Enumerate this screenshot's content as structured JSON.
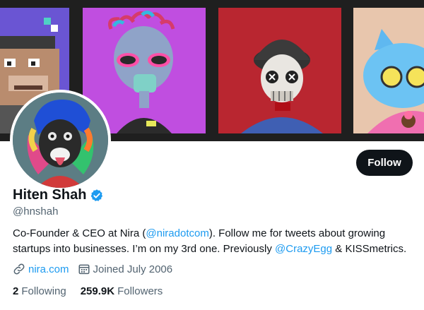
{
  "banner": {
    "nfts": [
      {
        "name": "pixel-ape"
      },
      {
        "name": "masked-alien"
      },
      {
        "name": "skull-soldier"
      },
      {
        "name": "cool-cat"
      }
    ]
  },
  "profile": {
    "display_name": "Hiten Shah",
    "handle": "@hnshah",
    "follow_label": "Follow",
    "bio": {
      "part1": "Co-Founder & CEO at Nira (",
      "mention1": "@niradotcom",
      "part2": "). Follow me for tweets about growing startups into businesses. I’m on my 3rd one. Previously ",
      "mention2": "@CrazyEgg",
      "part3": " & KISSmetrics."
    },
    "website": "nira.com",
    "joined": "Joined July 2006",
    "following_count": "2",
    "following_label": "Following",
    "followers_count": "259.9K",
    "followers_label": "Followers"
  },
  "colors": {
    "accent": "#1d9bf0",
    "text_primary": "#0f1419",
    "text_secondary": "#536471",
    "button_bg": "#0f1419"
  },
  "icons": {
    "verified": "verified-badge-icon",
    "link": "link-icon",
    "calendar": "calendar-icon"
  }
}
